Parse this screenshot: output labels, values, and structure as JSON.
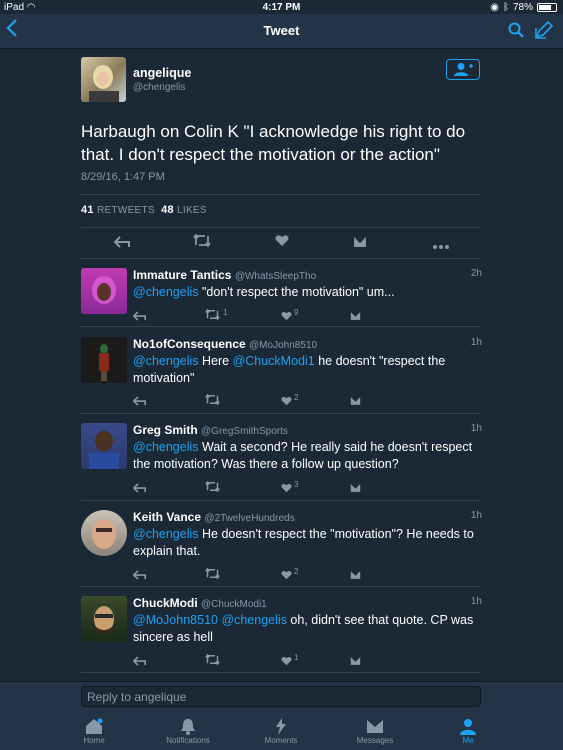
{
  "status_bar": {
    "device": "iPad",
    "time": "4:17 PM",
    "battery": "78%",
    "battery_level": 0.78
  },
  "nav": {
    "title": "Tweet"
  },
  "tweet": {
    "name": "angelique",
    "handle": "@chengelis",
    "text": "Harbaugh on Colin K \"I acknowledge his right to do that. I don't respect the motivation or the action\"",
    "timestamp": "8/29/16, 1:47 PM",
    "retweets": "41",
    "retweets_label": "RETWEETS",
    "likes": "48",
    "likes_label": "LIKES"
  },
  "replies": [
    {
      "name": "Immature Tantics",
      "handle": "@WhatsSleepTho",
      "time": "2h",
      "mentions": "@chengelis",
      "text": " \"don't respect the motivation\" um...",
      "retweets": "1",
      "likes": "9"
    },
    {
      "name": "No1ofConsequence",
      "handle": "@MoJohn8510",
      "time": "1h",
      "mentions": "@chengelis",
      "text_a": " Here ",
      "mention2": "@ChuckModi1",
      "text": " he doesn't \"respect the motivation\"",
      "retweets": "",
      "likes": "2"
    },
    {
      "name": "Greg Smith",
      "handle": "@GregSmithSports",
      "time": "1h",
      "mentions": "@chengelis",
      "text": " Wait a second? He really said he doesn't respect the motivation? Was there a follow up question?",
      "retweets": "",
      "likes": "3"
    },
    {
      "name": "Keith Vance",
      "handle": "@2TwelveHundreds",
      "time": "1h",
      "mentions": "@chengelis",
      "text": " He doesn't respect the \"motivation\"? He needs to explain that.",
      "retweets": "",
      "likes": "2"
    },
    {
      "name": "ChuckModi",
      "handle": "@ChuckModi1",
      "time": "1h",
      "mentions": "@MoJohn8510 @chengelis",
      "text": " oh, didn't see that quote. CP was sincere as hell",
      "retweets": "",
      "likes": "1"
    }
  ],
  "reply_box": {
    "placeholder": "Reply to angelique"
  },
  "tabs": [
    {
      "label": "Home",
      "icon": "home-icon"
    },
    {
      "label": "Notifications",
      "icon": "bell-icon"
    },
    {
      "label": "Moments",
      "icon": "lightning-icon"
    },
    {
      "label": "Messages",
      "icon": "envelope-icon"
    },
    {
      "label": "Me",
      "icon": "person-icon"
    }
  ],
  "colors": {
    "accent": "#1da1f2",
    "background": "#1b2836",
    "bar": "#243447",
    "muted": "#8899a6"
  }
}
